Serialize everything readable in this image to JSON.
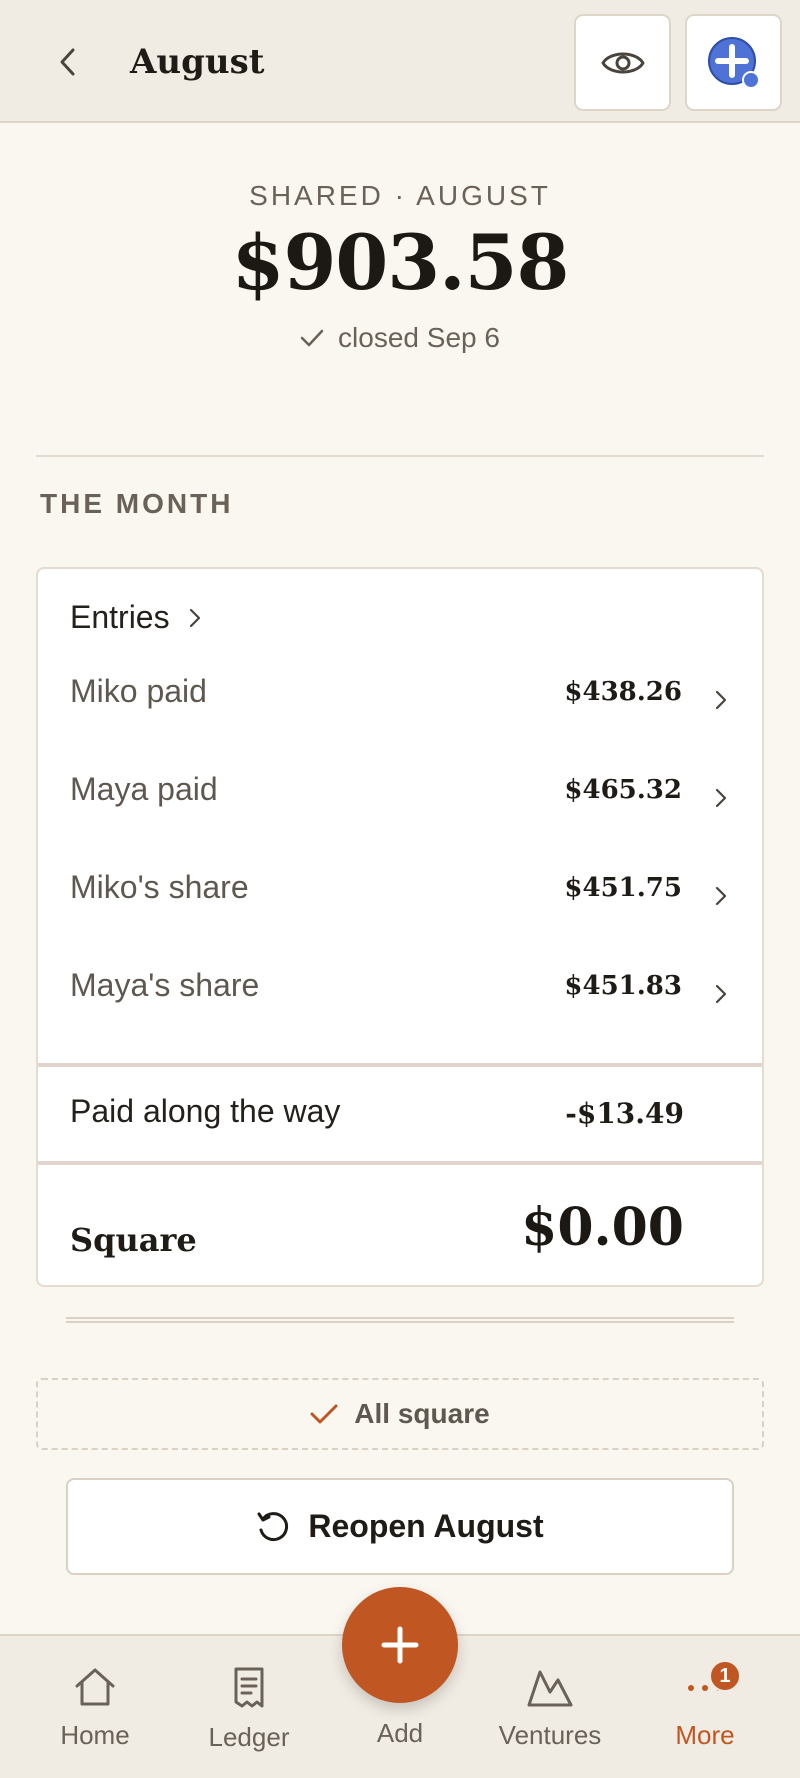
{
  "header": {
    "title": "August",
    "back_icon": "chevron-left-icon",
    "eye_icon": "eye-icon",
    "add_icon": "plus-circle-icon"
  },
  "summary": {
    "label": "SHARED · AUGUST",
    "amount": "$903.58",
    "closed_text": "closed Sep 6"
  },
  "month": {
    "section_label": "THE MONTH",
    "entries_label": "Entries",
    "rows": [
      {
        "label": "Miko paid",
        "amount": "$438.26"
      },
      {
        "label": "Maya paid",
        "amount": "$465.32"
      },
      {
        "label": "Miko's share",
        "amount": "$451.75"
      },
      {
        "label": "Maya's share",
        "amount": "$451.83"
      }
    ],
    "paid_along_label": "Paid along the way",
    "paid_along_amount": "-$13.49",
    "square_label": "Square",
    "square_amount": "$0.00"
  },
  "status": {
    "all_square": "All square"
  },
  "actions": {
    "reopen_label": "Reopen August"
  },
  "nav": {
    "items": [
      {
        "label": "Home",
        "icon": "home-icon"
      },
      {
        "label": "Ledger",
        "icon": "receipt-icon"
      },
      {
        "label": "Add",
        "icon": "plus-icon"
      },
      {
        "label": "Ventures",
        "icon": "mountain-icon"
      },
      {
        "label": "More",
        "icon": "more-icon",
        "badge": "1"
      }
    ]
  },
  "colors": {
    "accent": "#c05621",
    "background": "#faf7f1",
    "header_bg": "#f1ece3",
    "plus_blue": "#4f72d6"
  }
}
